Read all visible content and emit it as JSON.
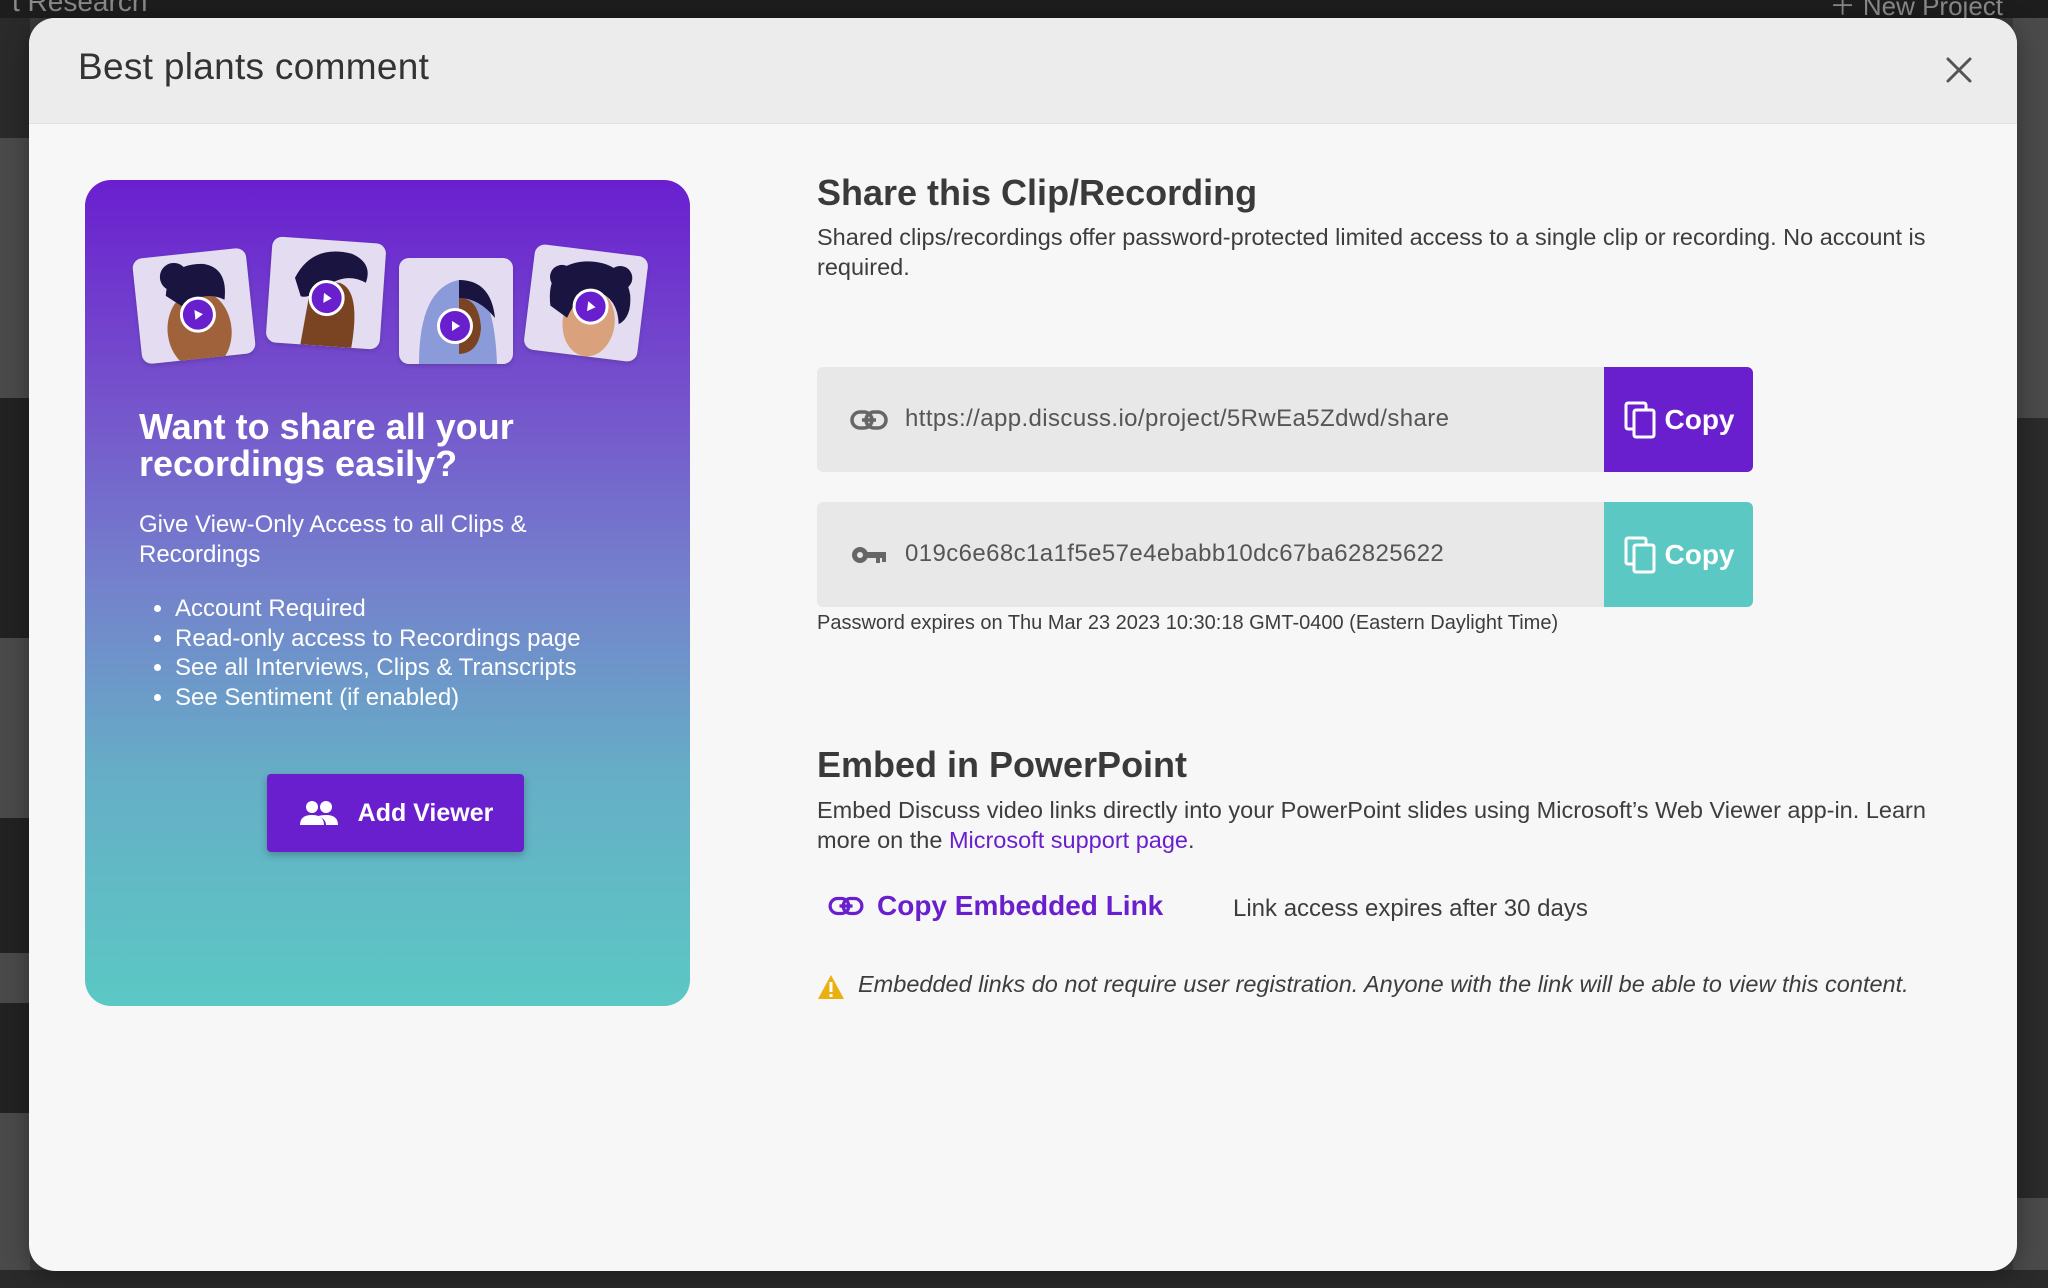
{
  "background": {
    "project_title": "t Research",
    "new_project_label": "New Project"
  },
  "modal": {
    "title": "Best plants comment"
  },
  "promo": {
    "heading": "Want to share all your recordings easily?",
    "description": "Give View-Only Access to all Clips & Recordings",
    "features": [
      "Account Required",
      "Read-only access to Recordings page",
      "See all Interviews, Clips & Transcripts",
      "See Sentiment (if enabled)"
    ],
    "add_viewer_label": "Add Viewer"
  },
  "share": {
    "title": "Share this Clip/Recording",
    "description": "Shared clips/recordings offer password-protected limited access to a single clip or recording. No account is required.",
    "url": "https://app.discuss.io/project/5RwEa5Zdwd/share",
    "password": "019c6e68c1a1f5e57e4ebabb10dc67ba62825622",
    "copy_label": "Copy",
    "password_expiry": "Password expires on Thu Mar 23 2023 10:30:18 GMT-0400 (Eastern Daylight Time)"
  },
  "embed": {
    "title": "Embed in PowerPoint",
    "description_before": "Embed Discuss video links directly into your PowerPoint slides using Microsoft’s Web Viewer app-in. Learn more on the ",
    "support_link_label": "Microsoft support page",
    "description_after": ".",
    "copy_link_label": "Copy Embedded Link",
    "link_expiry": "Link access expires after 30 days",
    "warning": "Embedded links do not require user registration. Anyone with the link will be able to view this content."
  },
  "colors": {
    "brand_purple": "#6a1fcf",
    "teal": "#5bc8c4",
    "warning_yellow": "#e9b010"
  }
}
